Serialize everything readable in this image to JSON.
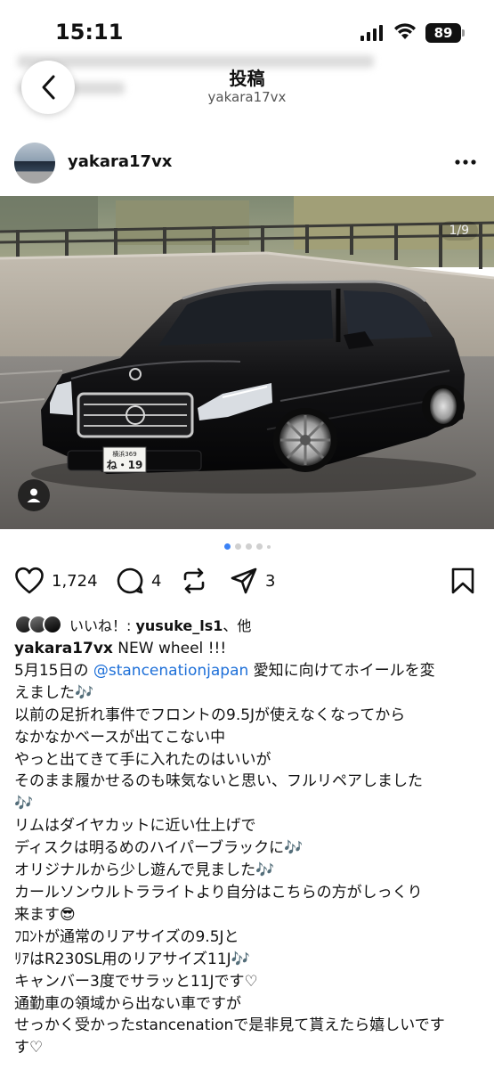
{
  "status_bar": {
    "time": "15:11",
    "battery": "89"
  },
  "header": {
    "title": "投稿",
    "subtitle": "yakara17vx"
  },
  "post": {
    "author": "yakara17vx",
    "photo_counter": "1/9",
    "carousel": {
      "total_dots": 5,
      "active_index": 0
    },
    "license_plate_top": "横浜369",
    "license_plate_bottom": "ね・19",
    "likes_count": "1,724",
    "comments_count": "4",
    "shares_count": "3",
    "liked_by_prefix": "いいね！: ",
    "liked_by_user": "yusuke_ls1",
    "liked_by_suffix": "、他",
    "caption_user": "yakara17vx",
    "caption_first": " NEW wheel !!!",
    "caption_line2_pre": "5月15日の ",
    "caption_mention": "@stancenationjapan",
    "caption_line2_post": " 愛知に向けてホイールを変",
    "caption_lines": [
      "えました🎶",
      "以前の足折れ事件でフロントの9.5Jが使えなくなってから",
      "なかなかベースが出てこない中",
      "やっと出てきて手に入れたのはいいが",
      "そのまま履かせるのも味気ないと思い、フルリペアしました",
      "🎶",
      "リムはダイヤカットに近い仕上げで",
      "ディスクは明るめのハイパーブラックに🎶",
      "オリジナルから少し遊んで見ました🎶",
      "カールソンウルトラライトより自分はこちらの方がしっくり",
      "来ます😎",
      "ﾌﾛﾝﾄが通常のリアサイズの9.5Jと",
      "ﾘｱはR230SL用のリアサイズ11J🎶",
      "キャンバー3度でサラッと11Jです♡",
      "通勤車の領域から出ない車ですが",
      "せっかく受かったstancenationで是非見て貰えたら嬉しいです",
      "す♡"
    ]
  },
  "colors": {
    "mention": "#1d6fd8",
    "active_dot": "#3b82f6"
  }
}
